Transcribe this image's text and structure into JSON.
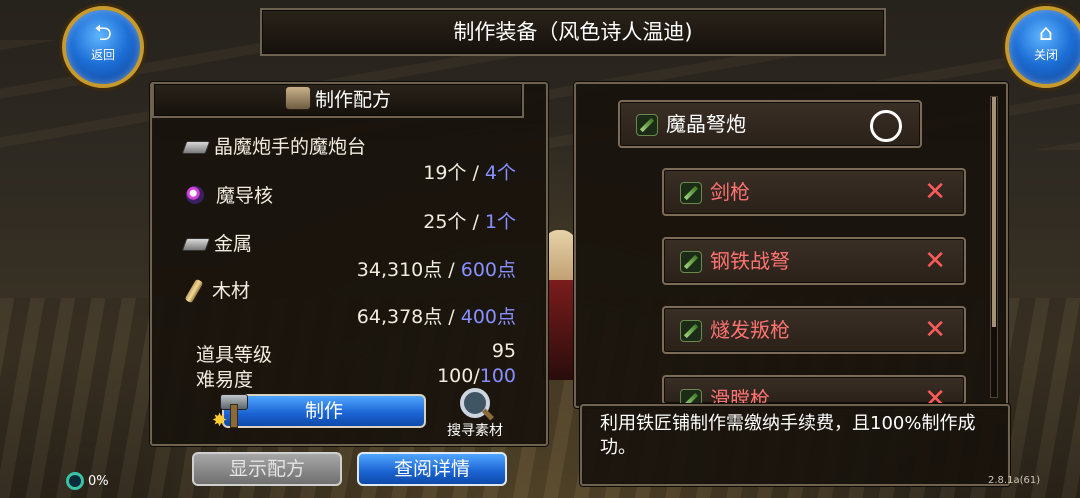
{
  "header": {
    "title": "制作装备（风色诗人温迪)",
    "back_label": "返回",
    "close_label": "关闭"
  },
  "recipe": {
    "header": "制作配方",
    "materials": [
      {
        "name": "晶魔炮手的魔炮台",
        "have": "19个",
        "need": "4个",
        "icon": "iron-ingot-icon"
      },
      {
        "name": "魔导核",
        "have": "25个",
        "need": "1个",
        "icon": "orb-icon"
      },
      {
        "name": "金属",
        "have": "34,310点",
        "need": "600点",
        "icon": "metal-icon"
      },
      {
        "name": "木材",
        "have": "64,378点",
        "need": "400点",
        "icon": "wood-icon"
      }
    ],
    "item_level_label": "道具等级",
    "item_level_value": "95",
    "difficulty_label": "难易度",
    "difficulty_have": "100",
    "difficulty_max": "100",
    "make_label": "制作",
    "search_label": "搜寻素材",
    "show_recipe_label": "显示配方",
    "view_details_label": "查阅详情"
  },
  "list": {
    "selected": {
      "name": "魔晶弩炮",
      "mark": "○"
    },
    "items": [
      {
        "name": "剑枪",
        "mark": "✕"
      },
      {
        "name": "钢铁战弩",
        "mark": "✕"
      },
      {
        "name": "燧发叛枪",
        "mark": "✕"
      },
      {
        "name": "滑膛枪",
        "mark": "✕"
      }
    ],
    "scroll_position": 0.0
  },
  "note": "利用铁匠铺制作需缴纳手续费，且100%制作成功。",
  "status": {
    "progress": "0%",
    "version": "2.8.1a(61)"
  },
  "colors": {
    "accent_blue": "#8890ff",
    "unavailable_red": "#ff7373",
    "button_blue": "#1a62d2",
    "frame_gold": "#c79a2d"
  }
}
